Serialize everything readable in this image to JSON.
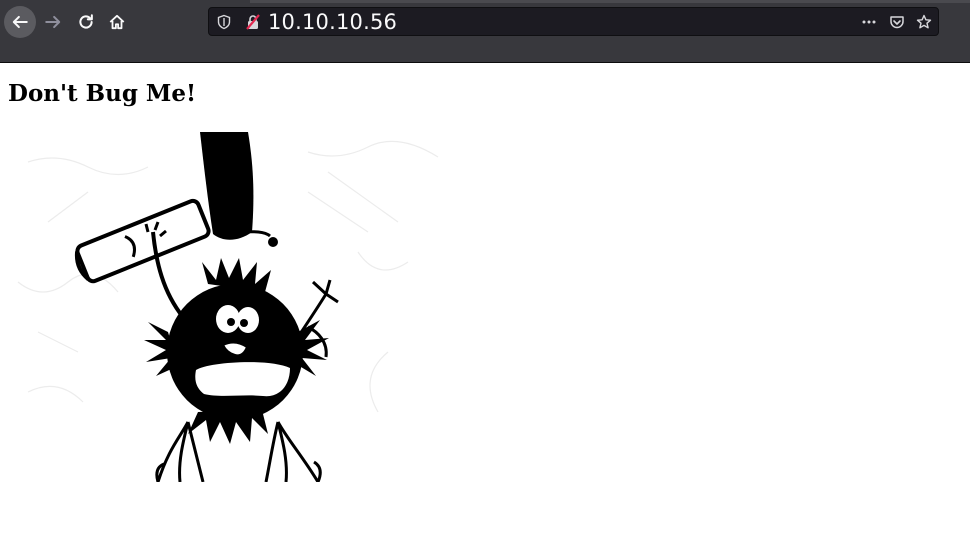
{
  "browser": {
    "url": "10.10.10.56",
    "icons": {
      "back": "arrow-left-icon",
      "forward": "arrow-right-icon",
      "reload": "reload-icon",
      "home": "home-icon",
      "tracking": "shield-icon",
      "insecure": "broken-lock-icon",
      "more": "ellipsis-icon",
      "pocket": "pocket-icon",
      "bookmark": "star-icon"
    }
  },
  "page": {
    "heading": "Don't Bug Me!",
    "image": {
      "description_icon": "bug-with-club-illustration"
    }
  },
  "colors": {
    "toolbar": "#38383d",
    "urlbar": "#1c1b22",
    "url_text": "#f9f9fa",
    "page_bg": "#ffffff",
    "insecure_accent": "#e22850"
  }
}
